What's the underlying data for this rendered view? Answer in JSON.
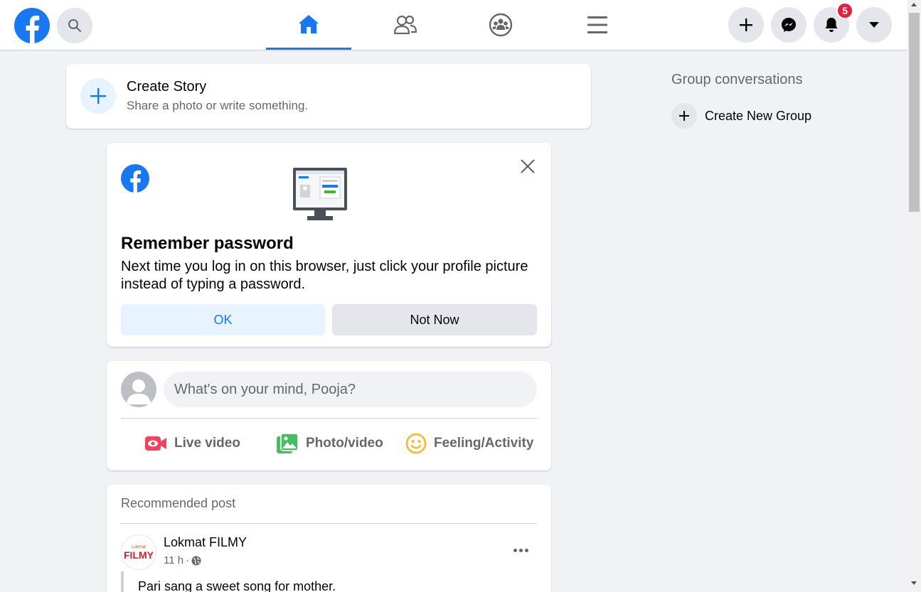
{
  "topbar": {
    "logo_icon": "facebook-logo-icon",
    "search_icon": "search-icon",
    "nav_tabs": [
      {
        "name": "home",
        "icon": "home-icon",
        "active": true
      },
      {
        "name": "friends",
        "icon": "friends-icon",
        "active": false
      },
      {
        "name": "groups",
        "icon": "groups-icon",
        "active": false
      },
      {
        "name": "menu",
        "icon": "hamburger-menu-icon",
        "active": false
      }
    ],
    "notification_count": "5",
    "accent_color": "#1877f2",
    "badge_color": "#e41e3f"
  },
  "create_story": {
    "title": "Create Story",
    "subtitle": "Share a photo or write something."
  },
  "remember_password": {
    "title": "Remember password",
    "text": "Next time you log in on this browser, just click your profile picture instead of typing a password.",
    "ok_label": "OK",
    "not_now_label": "Not Now"
  },
  "composer": {
    "placeholder": "What's on your mind, Pooja?",
    "actions": [
      {
        "label": "Live video",
        "icon": "live-video-icon",
        "color": "#f3425f"
      },
      {
        "label": "Photo/video",
        "icon": "photo-video-icon",
        "color": "#45bd62"
      },
      {
        "label": "Feeling/Activity",
        "icon": "feeling-icon",
        "color": "#f7b928"
      }
    ]
  },
  "recommended": {
    "label": "Recommended post",
    "page_name": "Lokmat FILMY",
    "time": "11 h",
    "separator": "·",
    "post_text": "Pari sang a sweet song for mother.",
    "avatar_text": "FILMY"
  },
  "right_column": {
    "title": "Group conversations",
    "create_group_label": "Create New Group"
  }
}
